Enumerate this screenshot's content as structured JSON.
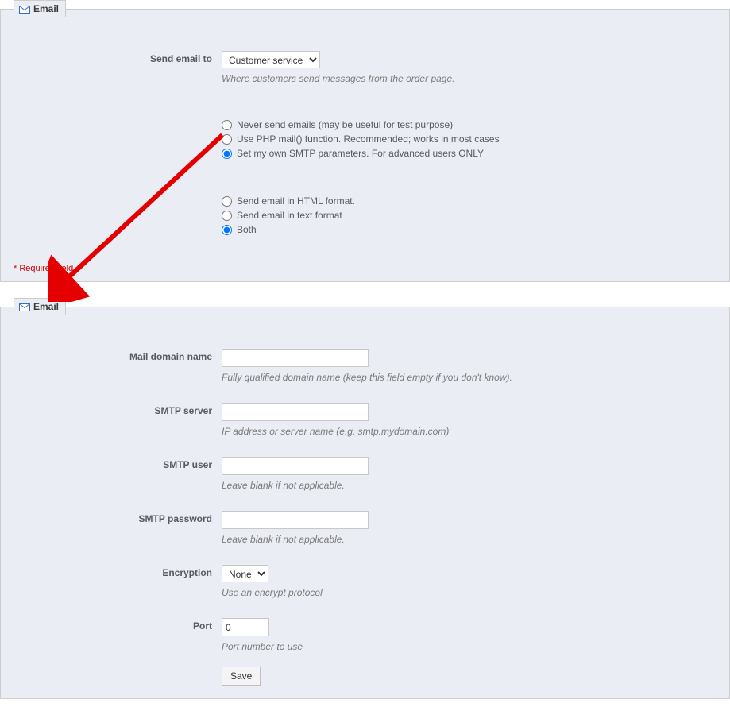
{
  "panel1": {
    "legend": "Email",
    "send_to_label": "Send email to",
    "send_to_options": [
      "Customer service"
    ],
    "send_to_value": "Customer service",
    "send_to_hint": "Where customers send messages from the order page.",
    "mode_options": {
      "never": "Never send emails (may be useful for test purpose)",
      "php": "Use PHP mail() function. Recommended; works in most cases",
      "smtp": "Set my own SMTP parameters. For advanced users ONLY"
    },
    "format_options": {
      "html": "Send email in HTML format.",
      "text": "Send email in text format",
      "both": "Both"
    },
    "required_note": "Required field"
  },
  "panel2": {
    "legend": "Email",
    "mail_domain": {
      "label": "Mail domain name",
      "value": "",
      "hint": "Fully qualified domain name (keep this field empty if you don't know)."
    },
    "smtp_server": {
      "label": "SMTP server",
      "value": "",
      "hint": "IP address or server name (e.g. smtp.mydomain.com)"
    },
    "smtp_user": {
      "label": "SMTP user",
      "value": "",
      "hint": "Leave blank if not applicable."
    },
    "smtp_pass": {
      "label": "SMTP password",
      "value": "",
      "hint": "Leave blank if not applicable."
    },
    "encryption": {
      "label": "Encryption",
      "options": [
        "None"
      ],
      "value": "None",
      "hint": "Use an encrypt protocol"
    },
    "port": {
      "label": "Port",
      "value": "0",
      "hint": "Port number to use"
    },
    "save": "Save"
  }
}
